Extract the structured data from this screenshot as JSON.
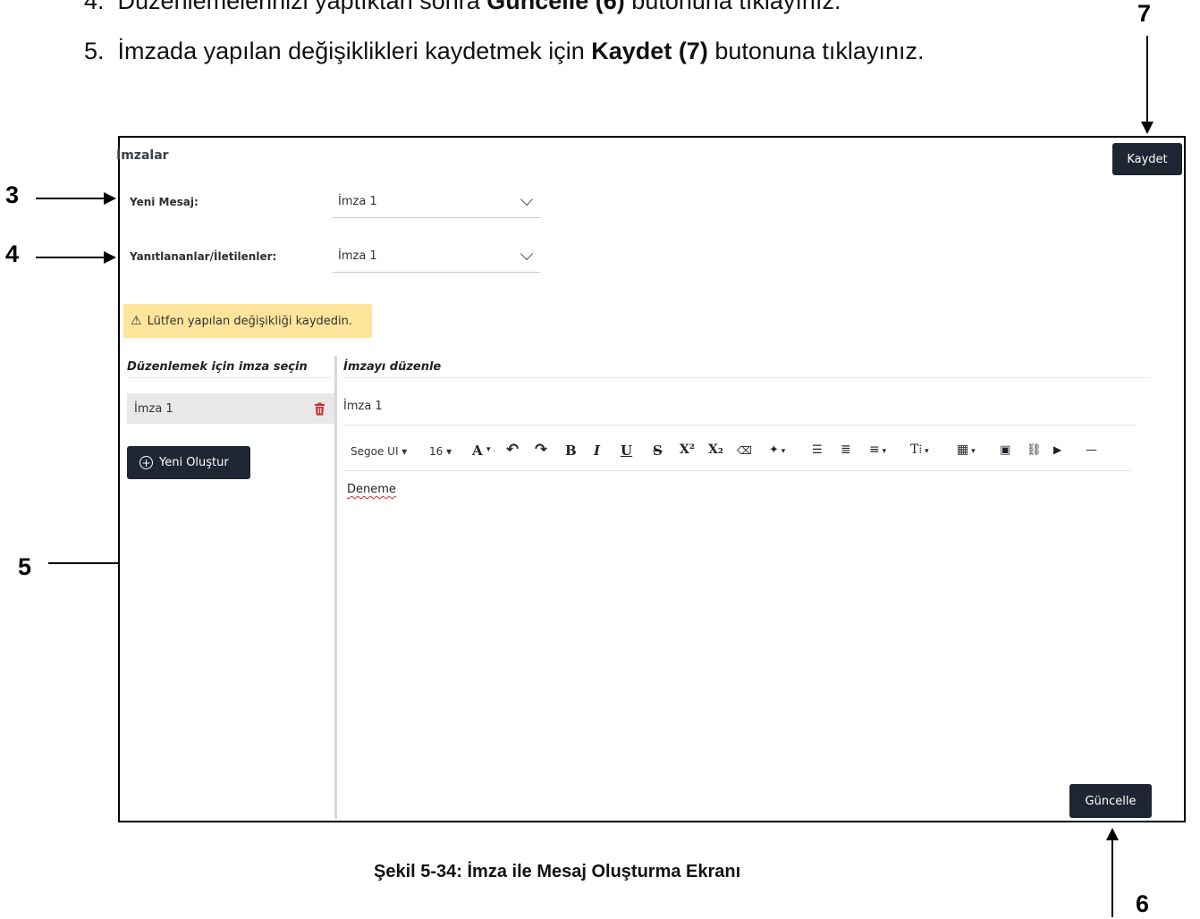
{
  "instructions": {
    "line4": {
      "number": "4.",
      "pre": "Düzenlemelerinizi yaptıktan sonra ",
      "bold": "Güncelle (6)",
      "post": " butonuna tıklayınız."
    },
    "line5": {
      "number": "5.",
      "pre": "İmzada yapılan değişiklikleri kaydetmek için ",
      "bold": "Kaydet (7)",
      "post": " butonuna tıklayınız."
    }
  },
  "callouts": {
    "c3": "3",
    "c4": "4",
    "c5": "5",
    "c6": "6",
    "c7": "7"
  },
  "app": {
    "title": "İmzalar",
    "save_label": "Kaydet",
    "new_message": {
      "label": "Yeni Mesaj:",
      "value": "İmza 1"
    },
    "replies": {
      "label": "Yanıtlananlar/İletilenler:",
      "value": "İmza 1"
    },
    "warning": {
      "icon": "warning-triangle-icon",
      "text": "Lütfen yapılan değişikliği kaydedin."
    },
    "list_heading": "Düzenlemek için imza seçin",
    "signatures": [
      {
        "name": "İmza 1"
      }
    ],
    "create_label": "Yeni Oluştur",
    "editor_heading": "İmzayı düzenle",
    "editor_name": "İmza 1",
    "toolbar": {
      "font": "Segoe UI",
      "size": "16",
      "items": [
        {
          "name": "font-color",
          "glyph": "A"
        },
        {
          "name": "undo",
          "glyph": "↶"
        },
        {
          "name": "redo",
          "glyph": "↷"
        },
        {
          "name": "bold",
          "glyph": "B"
        },
        {
          "name": "italic",
          "glyph": "I"
        },
        {
          "name": "underline",
          "glyph": "U"
        },
        {
          "name": "strikethrough",
          "glyph": "S"
        },
        {
          "name": "superscript",
          "glyph": "X²"
        },
        {
          "name": "subscript",
          "glyph": "X₂"
        },
        {
          "name": "clear-format",
          "glyph": "⌫"
        },
        {
          "name": "magic",
          "glyph": "✦"
        },
        {
          "name": "bullet-list",
          "glyph": "☰"
        },
        {
          "name": "numbered-list",
          "glyph": "≣"
        },
        {
          "name": "align",
          "glyph": "≡"
        },
        {
          "name": "text-style",
          "glyph": "T⁞"
        },
        {
          "name": "table",
          "glyph": "▦"
        },
        {
          "name": "image",
          "glyph": "▣"
        },
        {
          "name": "link",
          "glyph": "⛓"
        },
        {
          "name": "video",
          "glyph": "▶"
        },
        {
          "name": "horizontal-rule",
          "glyph": "—"
        }
      ]
    },
    "content": "Deneme",
    "update_label": "Güncelle"
  },
  "caption": "Şekil 5-34: İmza ile Mesaj Oluşturma Ekranı",
  "colors": {
    "dark_button": "#1e2633",
    "warning_bg": "#fde59b",
    "delete_red": "#d9262f"
  }
}
